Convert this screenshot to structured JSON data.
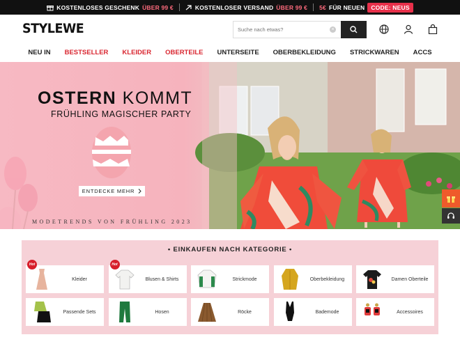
{
  "promo": {
    "gift_text": "KOSTENLOSES GESCHENK",
    "gift_threshold": "ÜBER 99 €",
    "shipping_text": "KOSTENLOSER VERSAND",
    "shipping_threshold": "ÜBER 99 €",
    "new_amount": "5€",
    "new_text": "FÜR NEUEN",
    "code_label": "CODE: NEUS"
  },
  "header": {
    "logo": "STYLEWE",
    "search_placeholder": "Suche nach etwas?",
    "clear_icon": "clear-icon",
    "icons": [
      "globe-icon",
      "user-icon",
      "bag-icon"
    ]
  },
  "nav": {
    "items": [
      {
        "label": "NEU IN",
        "highlight": false
      },
      {
        "label": "BESTSELLER",
        "highlight": true
      },
      {
        "label": "KLEIDER",
        "highlight": true
      },
      {
        "label": "OBERTEILE",
        "highlight": true
      },
      {
        "label": "UNTERSEITE",
        "highlight": false
      },
      {
        "label": "OBERBEKLEIDUNG",
        "highlight": false
      },
      {
        "label": "STRICKWAREN",
        "highlight": false
      },
      {
        "label": "ACCS",
        "highlight": false
      }
    ],
    "highlight_color": "#d92630"
  },
  "hero": {
    "title_bold": "OSTERN",
    "title_rest": "KOMMT",
    "subtitle": "FRÜHLING MAGISCHER PARTY",
    "cta": "ENTDECKE MEHR",
    "footer": "MODETRENDS VON FRÜHLING 2023"
  },
  "categories": {
    "title": "• EINKAUFEN NACH KATEGORIE •",
    "hot_badge": "Hot",
    "items": [
      {
        "label": "Kleider",
        "hot": true
      },
      {
        "label": "Blusen & Shirts",
        "hot": true
      },
      {
        "label": "Strickmode",
        "hot": false
      },
      {
        "label": "Oberbekleidung",
        "hot": false
      },
      {
        "label": "Damen Oberteile",
        "hot": false
      },
      {
        "label": "Passende Sets",
        "hot": false
      },
      {
        "label": "Hosen",
        "hot": false
      },
      {
        "label": "Röcke",
        "hot": false
      },
      {
        "label": "Bademode",
        "hot": false
      },
      {
        "label": "Accessoires",
        "hot": false
      }
    ]
  }
}
